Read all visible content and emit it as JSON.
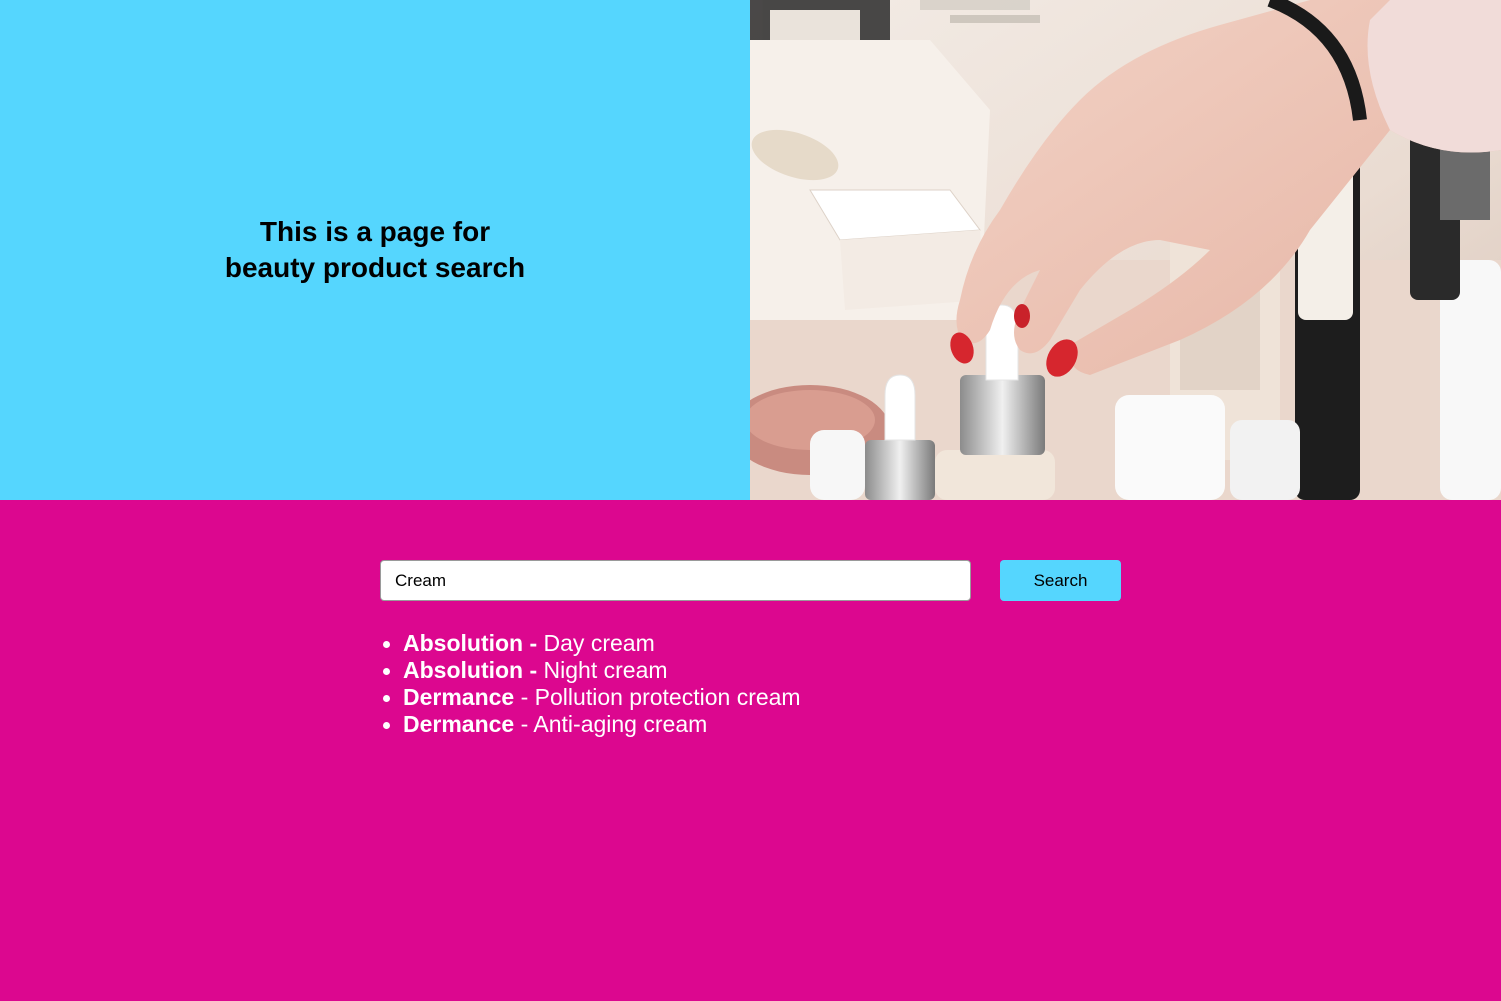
{
  "hero": {
    "title": "This is a page for\nbeauty product search",
    "image_alt": "hand picking a serum dropper bottle among cosmetics"
  },
  "search": {
    "value": "Cream",
    "placeholder": "",
    "button_label": "Search"
  },
  "results": [
    {
      "brand": "Absolution -",
      "name": "Day cream"
    },
    {
      "brand": "Absolution -",
      "name": "Night cream"
    },
    {
      "brand": "Dermance",
      "name": "- Pollution protection cream"
    },
    {
      "brand": "Dermance",
      "name": "- Anti-aging cream"
    }
  ],
  "colors": {
    "hero_left_bg": "#55d6fe",
    "page_bg": "#dc078f",
    "button_bg": "#55d6fe",
    "result_text": "#ffffff"
  }
}
